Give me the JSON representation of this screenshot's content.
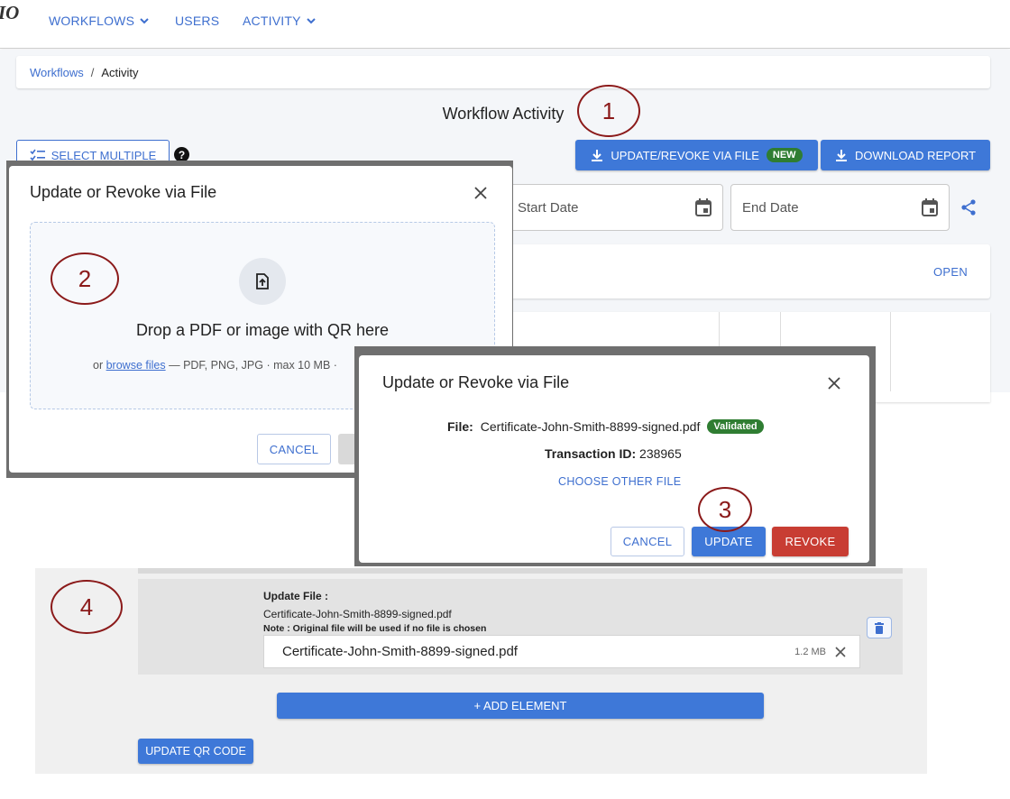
{
  "nav": {
    "logo": "IO",
    "items": [
      "WORKFLOWS",
      "USERS",
      "ACTIVITY"
    ]
  },
  "breadcrumb": {
    "root": "Workflows",
    "separator": "/",
    "current": "Activity"
  },
  "page": {
    "title": "Workflow Activity",
    "select_multiple": "SELECT MULTIPLE",
    "help_glyph": "?",
    "update_revoke_button": "UPDATE/REVOKE VIA FILE",
    "new_badge": "NEW",
    "download_report_button": "DOWNLOAD REPORT",
    "start_date_placeholder": "Start Date",
    "end_date_placeholder": "End Date",
    "open_link": "OPEN"
  },
  "modal_upload": {
    "title": "Update or Revoke via File",
    "drop_title": "Drop a PDF or image with QR here",
    "prefix": "or",
    "browse_link": "browse files",
    "formats": "— PDF, PNG, JPG · max 10 MB ·",
    "cancel": "CANCEL"
  },
  "modal_confirm": {
    "title": "Update or Revoke via File",
    "file_label": "File:",
    "file_name": "Certificate-John-Smith-8899-signed.pdf",
    "status_badge": "Validated",
    "transaction_label": "Transaction ID:",
    "transaction_id": "238965",
    "choose_other": "CHOOSE OTHER FILE",
    "cancel": "CANCEL",
    "update": "UPDATE",
    "revoke": "REVOKE"
  },
  "update_section": {
    "heading": "Update File :",
    "file_name": "Certificate-John-Smith-8899-signed.pdf",
    "note": "Note : Original file will be used if no file is chosen",
    "selected_file": "Certificate-John-Smith-8899-signed.pdf",
    "file_size": "1.2 MB",
    "add_element": "+ ADD ELEMENT",
    "update_qr": "UPDATE QR CODE"
  },
  "annotations": [
    "1",
    "2",
    "3",
    "4"
  ],
  "colors": {
    "primary": "#3e78d8",
    "link": "#3e6fcf",
    "success": "#2f7d32",
    "danger": "#c83d33",
    "annotation": "#8b1a1a"
  }
}
